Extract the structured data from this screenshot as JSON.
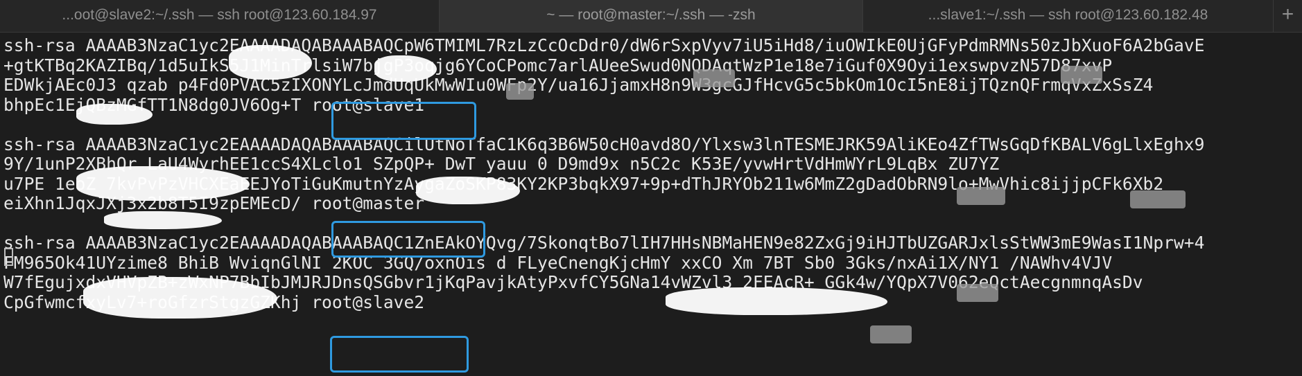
{
  "tabs": [
    {
      "label": "...oot@slave2:~/.ssh — ssh root@123.60.184.97"
    },
    {
      "label": "~ — root@master:~/.ssh — -zsh"
    },
    {
      "label": "...slave1:~/.ssh — ssh root@123.60.182.48"
    }
  ],
  "new_tab_label": "+",
  "terminal": {
    "lines": [
      "ssh-rsa AAAAB3NzaC1yc2EAAAADAQABAAABAQCpW6TMIML7RzLzCcOcDdr0/dW6rSxpVyv7iU5iHd8/iuOWIkE0UjGFyPdmRMNs50zJbXuoF6A2bGavE",
      "+gtKTBq2KAZIBq/1d5uIkS5J1MinTrlsiW7bjgP3oqjg6YCoCPomc7arlAUeeSwud0NQDAqtWzP1e18e7iGuf0X9Oyi1exswpvzN57D87xvP",
      "EDWkjAEc0J3 qzab p4Fd0PVAC5zIXONYLcJmdUqUkMwWIu0WFp2Y/ua16JjamxH8n9W3gcGJfHcvG5c5bkOm1OcI5nE8ijTQznQFrmqVxZxSsZ4",
      "bhpEc1EjQBzMGfTT1N8dg0JV6Og+T root@slave1",
      "",
      "ssh-rsa AAAAB3NzaC1yc2EAAAADAQABAAABAQCilUtNoTfaC1K6q3B6W50cH0avd8O/Ylxsw3lnTESMEJRK59AliKEo4ZfTWsGqDfKBALV6gLlxEghx9",
      "9Y/1unP2XBhQr LaU4WyrhEE1ccS4XLclo1 SZpQP+ DwT yauu 0 D9md9x n5C2c K53E/yvwHrtVdHmWYrL9LqBx ZU7YZ",
      "u7PE 1eoZ 7kvPvPzVHCXEaEEJYoTiGuKmutnYzAygaZoSKP83KY2KP3bqkX97+9p+dThJRYOb211w6MmZ2gDadObRN9lo+MwVhic8ijjpCFk6Xb2",
      "eiXhn1JqxJXj3x2b8T5I9zpEMEcD/ root@master",
      "",
      "ssh-rsa AAAAB3NzaC1yc2EAAAADAQABAAABAQC1ZnEAkOYQvg/7SkonqtBo7lIH7HHsNBMaHEN9e82ZxGj9iHJTbUZGARJxlsStWW3mE9WasI1Nprw+4",
      "FM965Ok41UYzime8 BhiB WviqnGlNI 2KOC 3GQ/oxnOis d FLyeCnengKjcHmY xxCO Xm 7BT Sb0 3Gks/nxAi1X/NY1 /NAWhv4VJV",
      "W7fEgujxdxVHVpZB+zWxNP7BbIbJMJRJDnsQSGbvr1jKqPavjkAtyPxvfCY5GNa14vWZvl3 2FEAcR+ GGk4w/YQpX7V062eQctAecgnmnqAsDv",
      "CpGfwmcfxyLv7+roGfzrStgzGZKhj root@slave2"
    ]
  }
}
